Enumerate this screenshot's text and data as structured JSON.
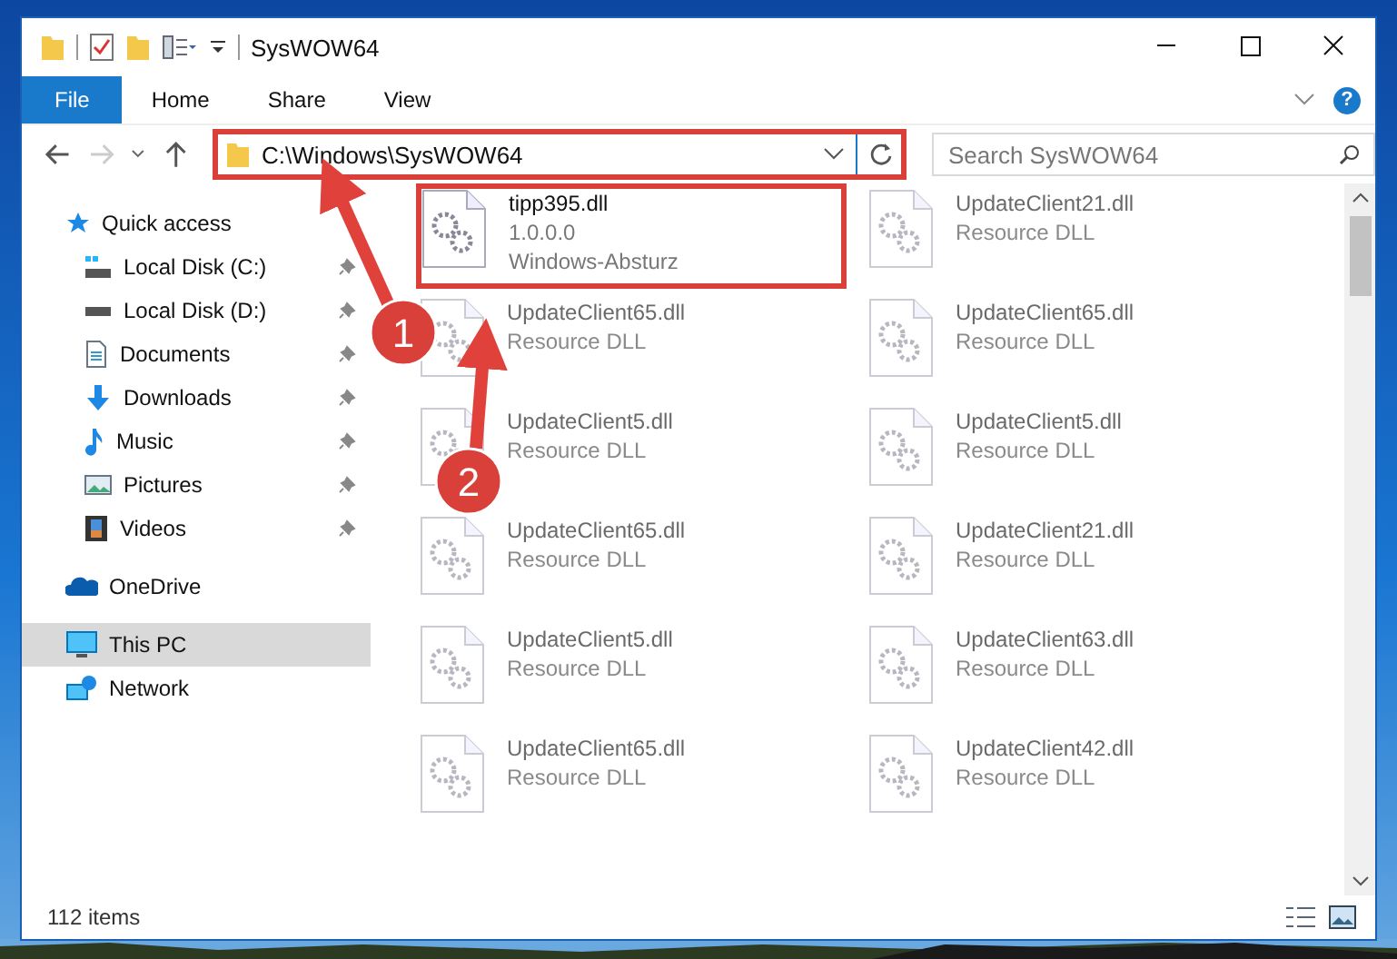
{
  "window": {
    "title": "SysWOW64"
  },
  "ribbon_tabs": [
    {
      "label": "File",
      "selected": true
    },
    {
      "label": "Home",
      "selected": false
    },
    {
      "label": "Share",
      "selected": false
    },
    {
      "label": "View",
      "selected": false
    }
  ],
  "help_button": "?",
  "address": {
    "value": "C:\\Windows\\SysWOW64",
    "marked": true
  },
  "search": {
    "placeholder": "Search SysWOW64"
  },
  "sidebar": {
    "items": [
      {
        "label": "Quick access",
        "kind": "star",
        "selected": false,
        "children": [
          {
            "label": "Local Disk (C:)",
            "kind": "drive-c",
            "selected": false,
            "pinned": true
          },
          {
            "label": "Local Disk (D:)",
            "kind": "drive",
            "selected": false,
            "pinned": true
          },
          {
            "label": "Documents",
            "kind": "documents",
            "selected": false,
            "pinned": true
          },
          {
            "label": "Downloads",
            "kind": "downloads",
            "selected": false,
            "pinned": true
          },
          {
            "label": "Music",
            "kind": "music",
            "selected": false,
            "pinned": true
          },
          {
            "label": "Pictures",
            "kind": "pictures",
            "selected": false,
            "pinned": true
          },
          {
            "label": "Videos",
            "kind": "videos",
            "selected": false,
            "pinned": true
          }
        ]
      },
      {
        "label": "OneDrive",
        "kind": "cloud",
        "selected": false
      },
      {
        "label": "This PC",
        "kind": "pc",
        "selected": true
      },
      {
        "label": "Network",
        "kind": "network",
        "selected": false
      }
    ]
  },
  "files": [
    {
      "name": "tipp395.dll",
      "details": [
        "1.0.0.0",
        "Windows-Absturz"
      ],
      "dimmed": false,
      "marked": true
    },
    {
      "name": "UpdateClient21.dll",
      "details": [
        "Resource DLL"
      ],
      "dimmed": true,
      "marked": false
    },
    {
      "name": "UpdateClient65.dll",
      "details": [
        "Resource DLL"
      ],
      "dimmed": true,
      "marked": false
    },
    {
      "name": "UpdateClient65.dll",
      "details": [
        "Resource DLL"
      ],
      "dimmed": true,
      "marked": false
    },
    {
      "name": "UpdateClient5.dll",
      "details": [
        "Resource DLL"
      ],
      "dimmed": true,
      "marked": false
    },
    {
      "name": "UpdateClient5.dll",
      "details": [
        "Resource DLL"
      ],
      "dimmed": true,
      "marked": false
    },
    {
      "name": "UpdateClient65.dll",
      "details": [
        "Resource DLL"
      ],
      "dimmed": true,
      "marked": false
    },
    {
      "name": "UpdateClient21.dll",
      "details": [
        "Resource DLL"
      ],
      "dimmed": true,
      "marked": false
    },
    {
      "name": "UpdateClient5.dll",
      "details": [
        "Resource DLL"
      ],
      "dimmed": true,
      "marked": false
    },
    {
      "name": "UpdateClient63.dll",
      "details": [
        "Resource DLL"
      ],
      "dimmed": true,
      "marked": false
    },
    {
      "name": "UpdateClient65.dll",
      "details": [
        "Resource DLL"
      ],
      "dimmed": true,
      "marked": false
    },
    {
      "name": "UpdateClient42.dll",
      "details": [
        "Resource DLL"
      ],
      "dimmed": true,
      "marked": false
    }
  ],
  "annotations": [
    {
      "label": "1"
    },
    {
      "label": "2"
    }
  ],
  "status_bar": {
    "count": "112 items"
  }
}
